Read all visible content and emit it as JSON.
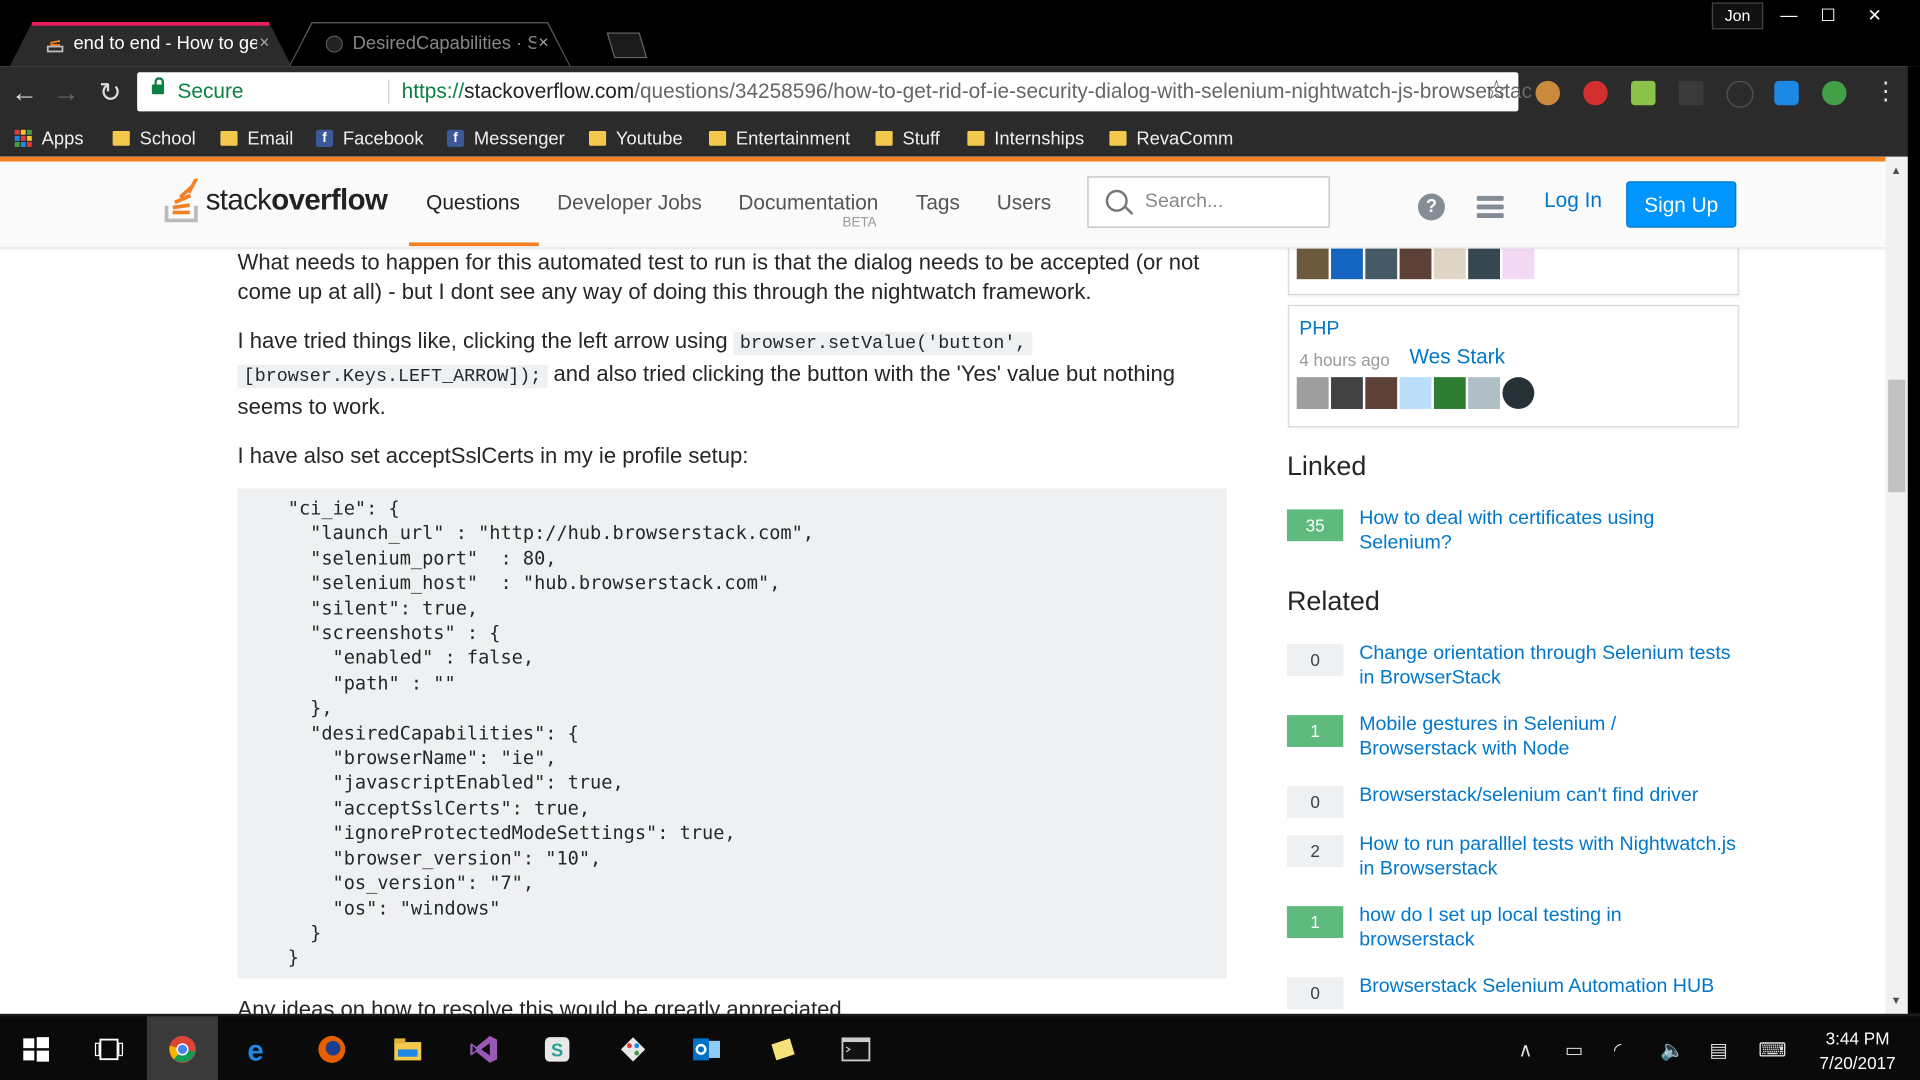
{
  "browser": {
    "tabs": [
      {
        "title": "end to end - How to get",
        "close": "×",
        "icon": "stackoverflow-favicon"
      },
      {
        "title": "DesiredCapabilities · Sele",
        "close": "×",
        "icon": "github-favicon"
      }
    ],
    "user": "Jon",
    "window_buttons": {
      "minimize": "—",
      "maximize": "☐",
      "close": "✕"
    },
    "nav": {
      "back": "←",
      "forward": "→",
      "reload": "↻"
    },
    "secure_label": "Secure",
    "url": {
      "protocol": "https://",
      "host": "stackoverflow.com",
      "path": "/questions/34258596/how-to-get-rid-of-ie-security-dialog-with-selenium-nightwatch-js-browserstac"
    },
    "star": "☆",
    "menu": "⋮",
    "bookmarks": [
      {
        "label": "Apps",
        "icon": "apps-grid-icon"
      },
      {
        "label": "School",
        "icon": "folder-icon"
      },
      {
        "label": "Email",
        "icon": "folder-icon"
      },
      {
        "label": "Facebook",
        "icon": "facebook-icon"
      },
      {
        "label": "Messenger",
        "icon": "facebook-icon"
      },
      {
        "label": "Youtube",
        "icon": "folder-icon"
      },
      {
        "label": "Entertainment",
        "icon": "folder-icon"
      },
      {
        "label": "Stuff",
        "icon": "folder-icon"
      },
      {
        "label": "Internships",
        "icon": "folder-icon"
      },
      {
        "label": "RevaComm",
        "icon": "folder-icon"
      }
    ]
  },
  "so": {
    "logo_light": "stack",
    "logo_bold": "overflow",
    "nav": [
      "Questions",
      "Developer Jobs",
      "Documentation",
      "Tags",
      "Users"
    ],
    "beta": "BETA",
    "search_placeholder": "Search...",
    "help": "?",
    "login": "Log In",
    "signup": "Sign Up",
    "accent": "#f48024",
    "link": "#0077cc"
  },
  "post": {
    "p1": "What needs to happen for this automated test to run is that the dialog needs to be accepted (or not come up at all) - but I dont see any way of doing this through the nightwatch framework.",
    "p2_a": "I have tried things like, clicking the left arrow using ",
    "p2_code1": "browser.setValue('button',",
    "p2_code2": "[browser.Keys.LEFT_ARROW]);",
    "p2_b": " and also tried clicking the button with the 'Yes' value but nothing seems to work.",
    "p3": "I have also set acceptSslCerts in my ie profile setup:",
    "code": "\"ci_ie\": {\n  \"launch_url\" : \"http://hub.browserstack.com\",\n  \"selenium_port\"  : 80,\n  \"selenium_host\"  : \"hub.browserstack.com\",\n  \"silent\": true,\n  \"screenshots\" : {\n    \"enabled\" : false,\n    \"path\" : \"\"\n  },\n  \"desiredCapabilities\": {\n    \"browserName\": \"ie\",\n    \"javascriptEnabled\": true,\n    \"acceptSslCerts\": true,\n    \"ignoreProtectedModeSettings\": true,\n    \"browser_version\": \"10\",\n    \"os_version\": \"7\",\n    \"os\": \"windows\"\n  }\n}",
    "p4": "Any ideas on how to resolve this would be greatly appreciated."
  },
  "sidebar": {
    "php_card": {
      "tag": "PHP",
      "ago": "4 hours ago",
      "user": "Wes Stark"
    },
    "linked_heading": "Linked",
    "linked": [
      {
        "score": "35",
        "answered": true,
        "title": "How to deal with certificates using Selenium?"
      }
    ],
    "related_heading": "Related",
    "related": [
      {
        "score": "0",
        "answered": false,
        "title": "Change orientation through Selenium tests in BrowserStack"
      },
      {
        "score": "1",
        "answered": true,
        "title": "Mobile gestures in Selenium / Browserstack with Node"
      },
      {
        "score": "0",
        "answered": false,
        "title": "Browserstack/selenium can't find driver"
      },
      {
        "score": "2",
        "answered": false,
        "title": "How to run paralllel tests with Nightwatch.js in Browserstack"
      },
      {
        "score": "1",
        "answered": true,
        "title": "how do I set up local testing in browserstack"
      },
      {
        "score": "0",
        "answered": false,
        "title": "Browserstack Selenium Automation HUB"
      }
    ]
  },
  "taskbar": {
    "apps": [
      "start-icon",
      "task-view-icon",
      "chrome-icon",
      "edge-icon",
      "firefox-icon",
      "file-explorer-icon",
      "visual-studio-icon",
      "slack-icon",
      "git-icon",
      "outlook-icon",
      "sticky-notes-icon",
      "terminal-icon"
    ],
    "time": "3:44 PM",
    "date": "7/20/2017"
  }
}
